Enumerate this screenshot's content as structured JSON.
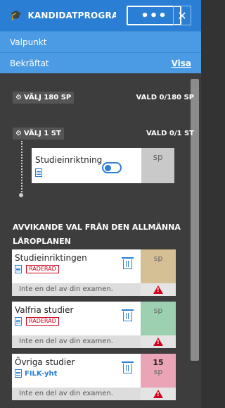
{
  "header": {
    "title": "KANDIDATPROGRAM",
    "more_label": "•••",
    "close_label": "✕"
  },
  "rows": {
    "valpunkt": "Valpunkt",
    "bekraftat": "Bekräftat",
    "visa": "Visa"
  },
  "selection": {
    "group1": {
      "label": "VÄLJ 180 SP",
      "status": "VALD 0/180 SP"
    },
    "group2": {
      "label": "VÄLJ 1 ST",
      "status": "VALD 0/1 ST"
    }
  },
  "study_card": {
    "name": "Studieinriktning",
    "sp": "sp",
    "sp_color": "#c9c9c9"
  },
  "deviating": {
    "heading": "AVVIKANDE VAL FRÅN DEN ALLMÄNNA LÄROPLANEN",
    "cards": [
      {
        "name": "Studieinriktingen",
        "tag": "RADERAD",
        "sp": "sp",
        "sp_value": "",
        "note": "Inte en del av din examen.",
        "color": "#d5bf95"
      },
      {
        "name": "Valfria studier",
        "tag": "RADERAD",
        "sp": "sp",
        "sp_value": "",
        "note": "Inte en del av din examen.",
        "color": "#9dcfb1"
      },
      {
        "name": "Övriga studier",
        "link": "FILK-yht",
        "sp": "sp",
        "sp_value": "15",
        "note": "Inte en del av din examen.",
        "color": "#eba4b5"
      }
    ]
  },
  "colors": {
    "accent": "#2a7fd4",
    "header": "#2a7fd4",
    "subheader": "#4a9ae4",
    "danger": "#d0021b"
  }
}
